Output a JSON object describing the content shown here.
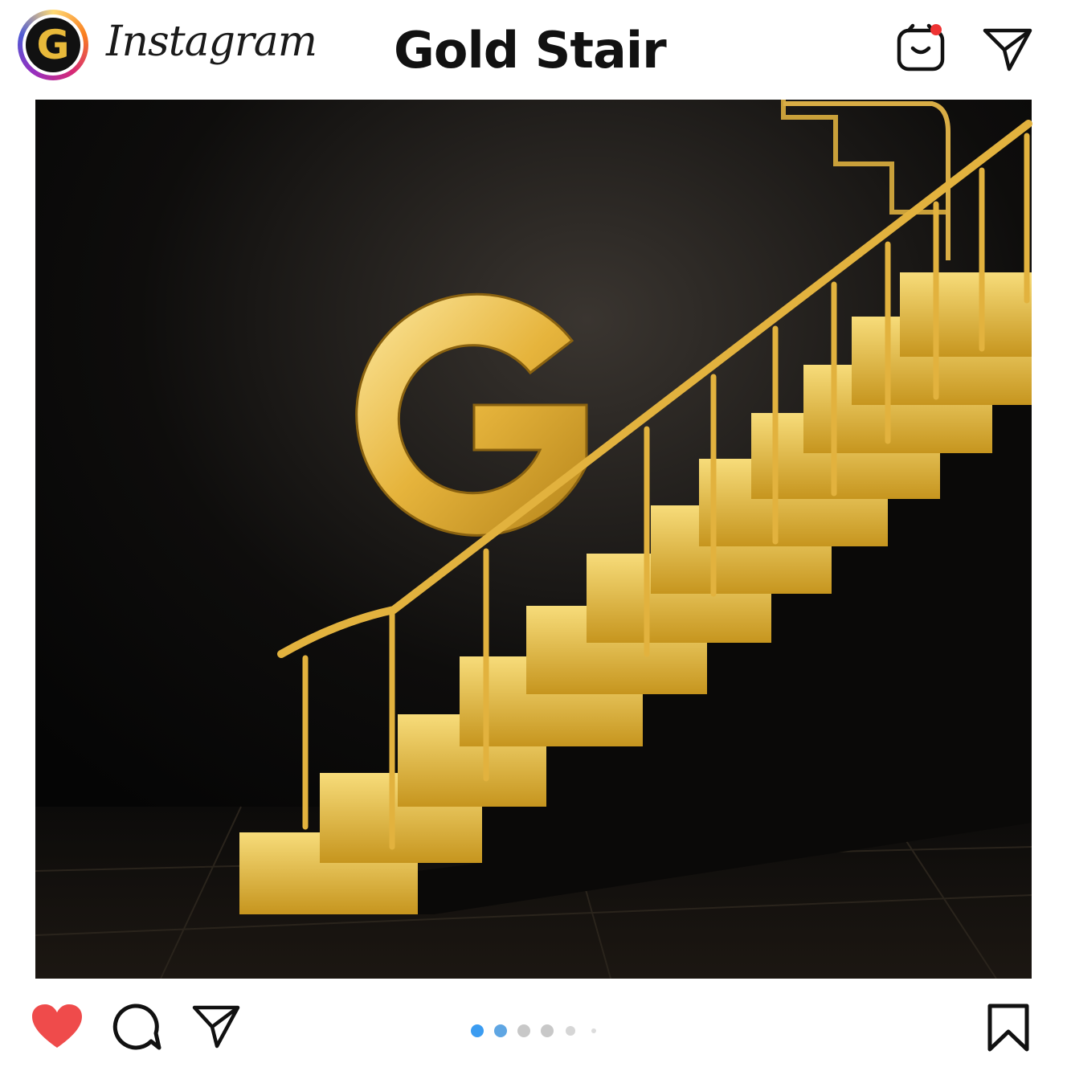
{
  "header": {
    "avatar_letter": "G",
    "app_name": "Instagram",
    "post_title": "Gold Stair",
    "icons": [
      "notifications-icon",
      "direct-message-icon"
    ]
  },
  "post": {
    "image_subject": "gold-stair-with-g-logo",
    "carousel": {
      "count": 6,
      "active_index": 0
    }
  },
  "footer": {
    "icons": [
      "heart-icon",
      "comment-icon",
      "share-icon",
      "bookmark-icon"
    ]
  },
  "colors": {
    "gold": "#e8b93a",
    "like_red": "#ef4b4b",
    "dot_active": "#3b9cf1",
    "background_dark": "#050505"
  }
}
